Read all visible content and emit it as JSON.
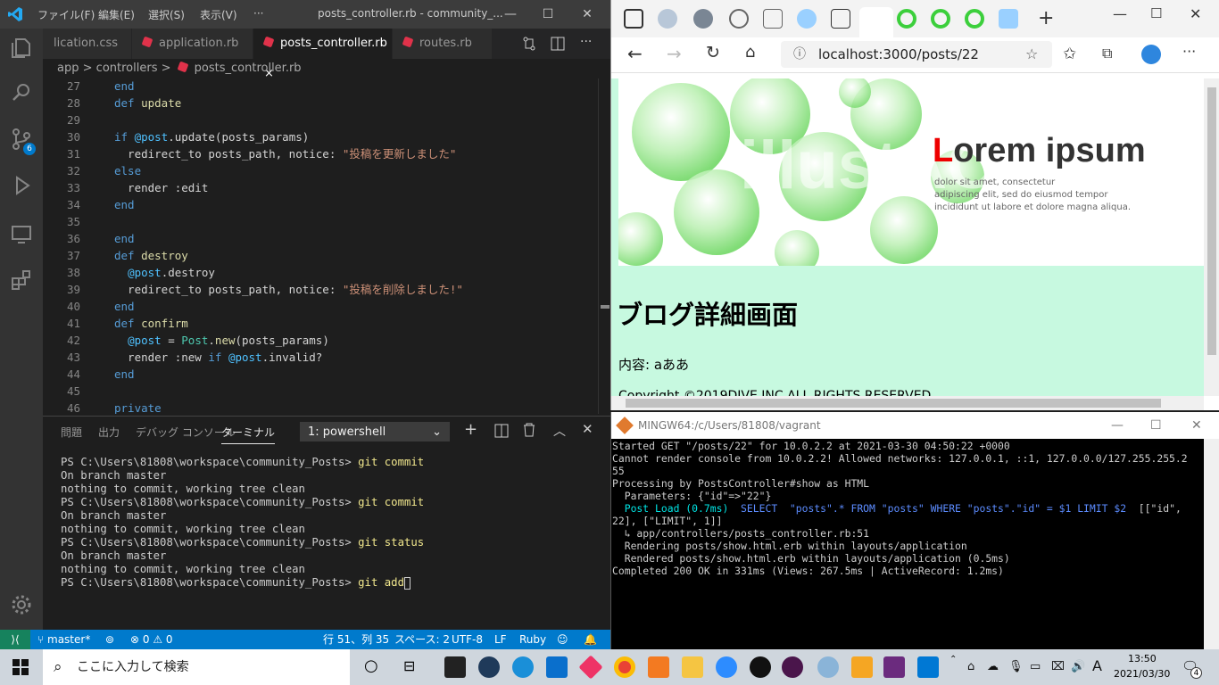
{
  "vscode": {
    "menu": [
      "ファイル(F)",
      "編集(E)",
      "選択(S)",
      "表示(V)",
      "···"
    ],
    "window_title": "posts_controller.rb - community_...",
    "badge_count": "6",
    "tabs": [
      {
        "label": "lication.css"
      },
      {
        "label": "application.rb"
      },
      {
        "label": "posts_controller.rb"
      },
      {
        "label": "routes.rb"
      }
    ],
    "close_glyph": "×",
    "breadcrumb": {
      "part1": "app",
      "sep": ">",
      "part2": "controllers",
      "part3": "posts_controller.rb"
    },
    "code_lines": [
      {
        "n": "27",
        "t": "end"
      },
      {
        "n": "28",
        "t": "def update"
      },
      {
        "n": "29",
        "t": ""
      },
      {
        "n": "30",
        "t": "if @post.update(posts_params)"
      },
      {
        "n": "31",
        "t": "  redirect_to posts_path, notice: \"投稿を更新しました\""
      },
      {
        "n": "32",
        "t": "else"
      },
      {
        "n": "33",
        "t": "  render :edit"
      },
      {
        "n": "34",
        "t": "end"
      },
      {
        "n": "35",
        "t": ""
      },
      {
        "n": "36",
        "t": "end"
      },
      {
        "n": "37",
        "t": "def destroy"
      },
      {
        "n": "38",
        "t": "  @post.destroy"
      },
      {
        "n": "39",
        "t": "  redirect_to posts_path, notice: \"投稿を削除しました!\""
      },
      {
        "n": "40",
        "t": "end"
      },
      {
        "n": "41",
        "t": "def confirm"
      },
      {
        "n": "42",
        "t": "  @post = Post.new(posts_params)"
      },
      {
        "n": "43",
        "t": "  render :new if @post.invalid?"
      },
      {
        "n": "44",
        "t": "end"
      },
      {
        "n": "45",
        "t": ""
      },
      {
        "n": "46",
        "t": "private"
      }
    ],
    "panel_tabs": [
      "問題",
      "出力",
      "デバッグ コンソール",
      "ターミナル"
    ],
    "terminal_select": "1: powershell",
    "terminal_lines": [
      {
        "prompt": "PS C:\\Users\\81808\\workspace\\community_Posts> ",
        "cmd": "git commit"
      },
      {
        "prompt": "On branch master",
        "cmd": ""
      },
      {
        "prompt": "nothing to commit, working tree clean",
        "cmd": ""
      },
      {
        "prompt": "PS C:\\Users\\81808\\workspace\\community_Posts> ",
        "cmd": "git commit"
      },
      {
        "prompt": "On branch master",
        "cmd": ""
      },
      {
        "prompt": "nothing to commit, working tree clean",
        "cmd": ""
      },
      {
        "prompt": "PS C:\\Users\\81808\\workspace\\community_Posts> ",
        "cmd": "git status"
      },
      {
        "prompt": "On branch master",
        "cmd": ""
      },
      {
        "prompt": "nothing to commit, working tree clean",
        "cmd": ""
      },
      {
        "prompt": "PS C:\\Users\\81808\\workspace\\community_Posts> ",
        "cmd": "git add"
      }
    ],
    "status": {
      "branch": "master*",
      "problems": "⊗ 0 ⚠ 0",
      "position": "行 51、列 35",
      "spaces": "スペース: 2",
      "encoding": "UTF-8",
      "eol": "LF",
      "language": "Ruby"
    }
  },
  "browser": {
    "address": "localhost:3000/posts/22",
    "hero": {
      "watermark": "illustAC",
      "title_first": "L",
      "title_rest": "orem ipsum",
      "body1": "dolor sit amet, consectetur",
      "body2": "adipiscing elit, sed do eiusmod tempor",
      "body3": "incididunt ut labore et dolore magna aliqua."
    },
    "heading": "ブログ詳細画面",
    "content": "内容: aああ",
    "footer": "Copyright ©2019DIVE INC ALL RIGHTS RESERVED"
  },
  "mingw": {
    "title": "MINGW64:/c/Users/81808/vagrant",
    "lines": [
      {
        "a": "Started GET \"/posts/22\" for 10.0.2.2 at 2021-03-30 04:50:22 +0000",
        "b": "",
        "c": ""
      },
      {
        "a": "Cannot render console from 10.0.2.2! Allowed networks: 127.0.0.1, ::1, 127.0.0.0/127.255.255.2",
        "b": "",
        "c": ""
      },
      {
        "a": "55",
        "b": "",
        "c": ""
      },
      {
        "a": "Processing by PostsController#show as HTML",
        "b": "",
        "c": ""
      },
      {
        "a": "  Parameters: {\"id\"=>\"22\"}",
        "b": "",
        "c": ""
      },
      {
        "a": "  ",
        "b": "Post Load (0.7ms)",
        "c": "  SELECT  \"posts\".* FROM \"posts\" WHERE \"posts\".\"id\" = $1 LIMIT $2",
        "d": "  [[\"id\","
      },
      {
        "a": "22], [\"LIMIT\", 1]]",
        "b": "",
        "c": ""
      },
      {
        "a": "  ↳ app/controllers/posts_controller.rb:51",
        "b": "",
        "c": ""
      },
      {
        "a": "  Rendering posts/show.html.erb within layouts/application",
        "b": "",
        "c": ""
      },
      {
        "a": "  Rendered posts/show.html.erb within layouts/application (0.5ms)",
        "b": "",
        "c": ""
      },
      {
        "a": "Completed 200 OK in 331ms (Views: 267.5ms | ActiveRecord: 1.2ms)",
        "b": "",
        "c": ""
      }
    ]
  },
  "taskbar": {
    "search_placeholder": "ここに入力して検索",
    "time": "13:50",
    "date": "2021/03/30",
    "ime": "A",
    "notif_count": "4"
  }
}
